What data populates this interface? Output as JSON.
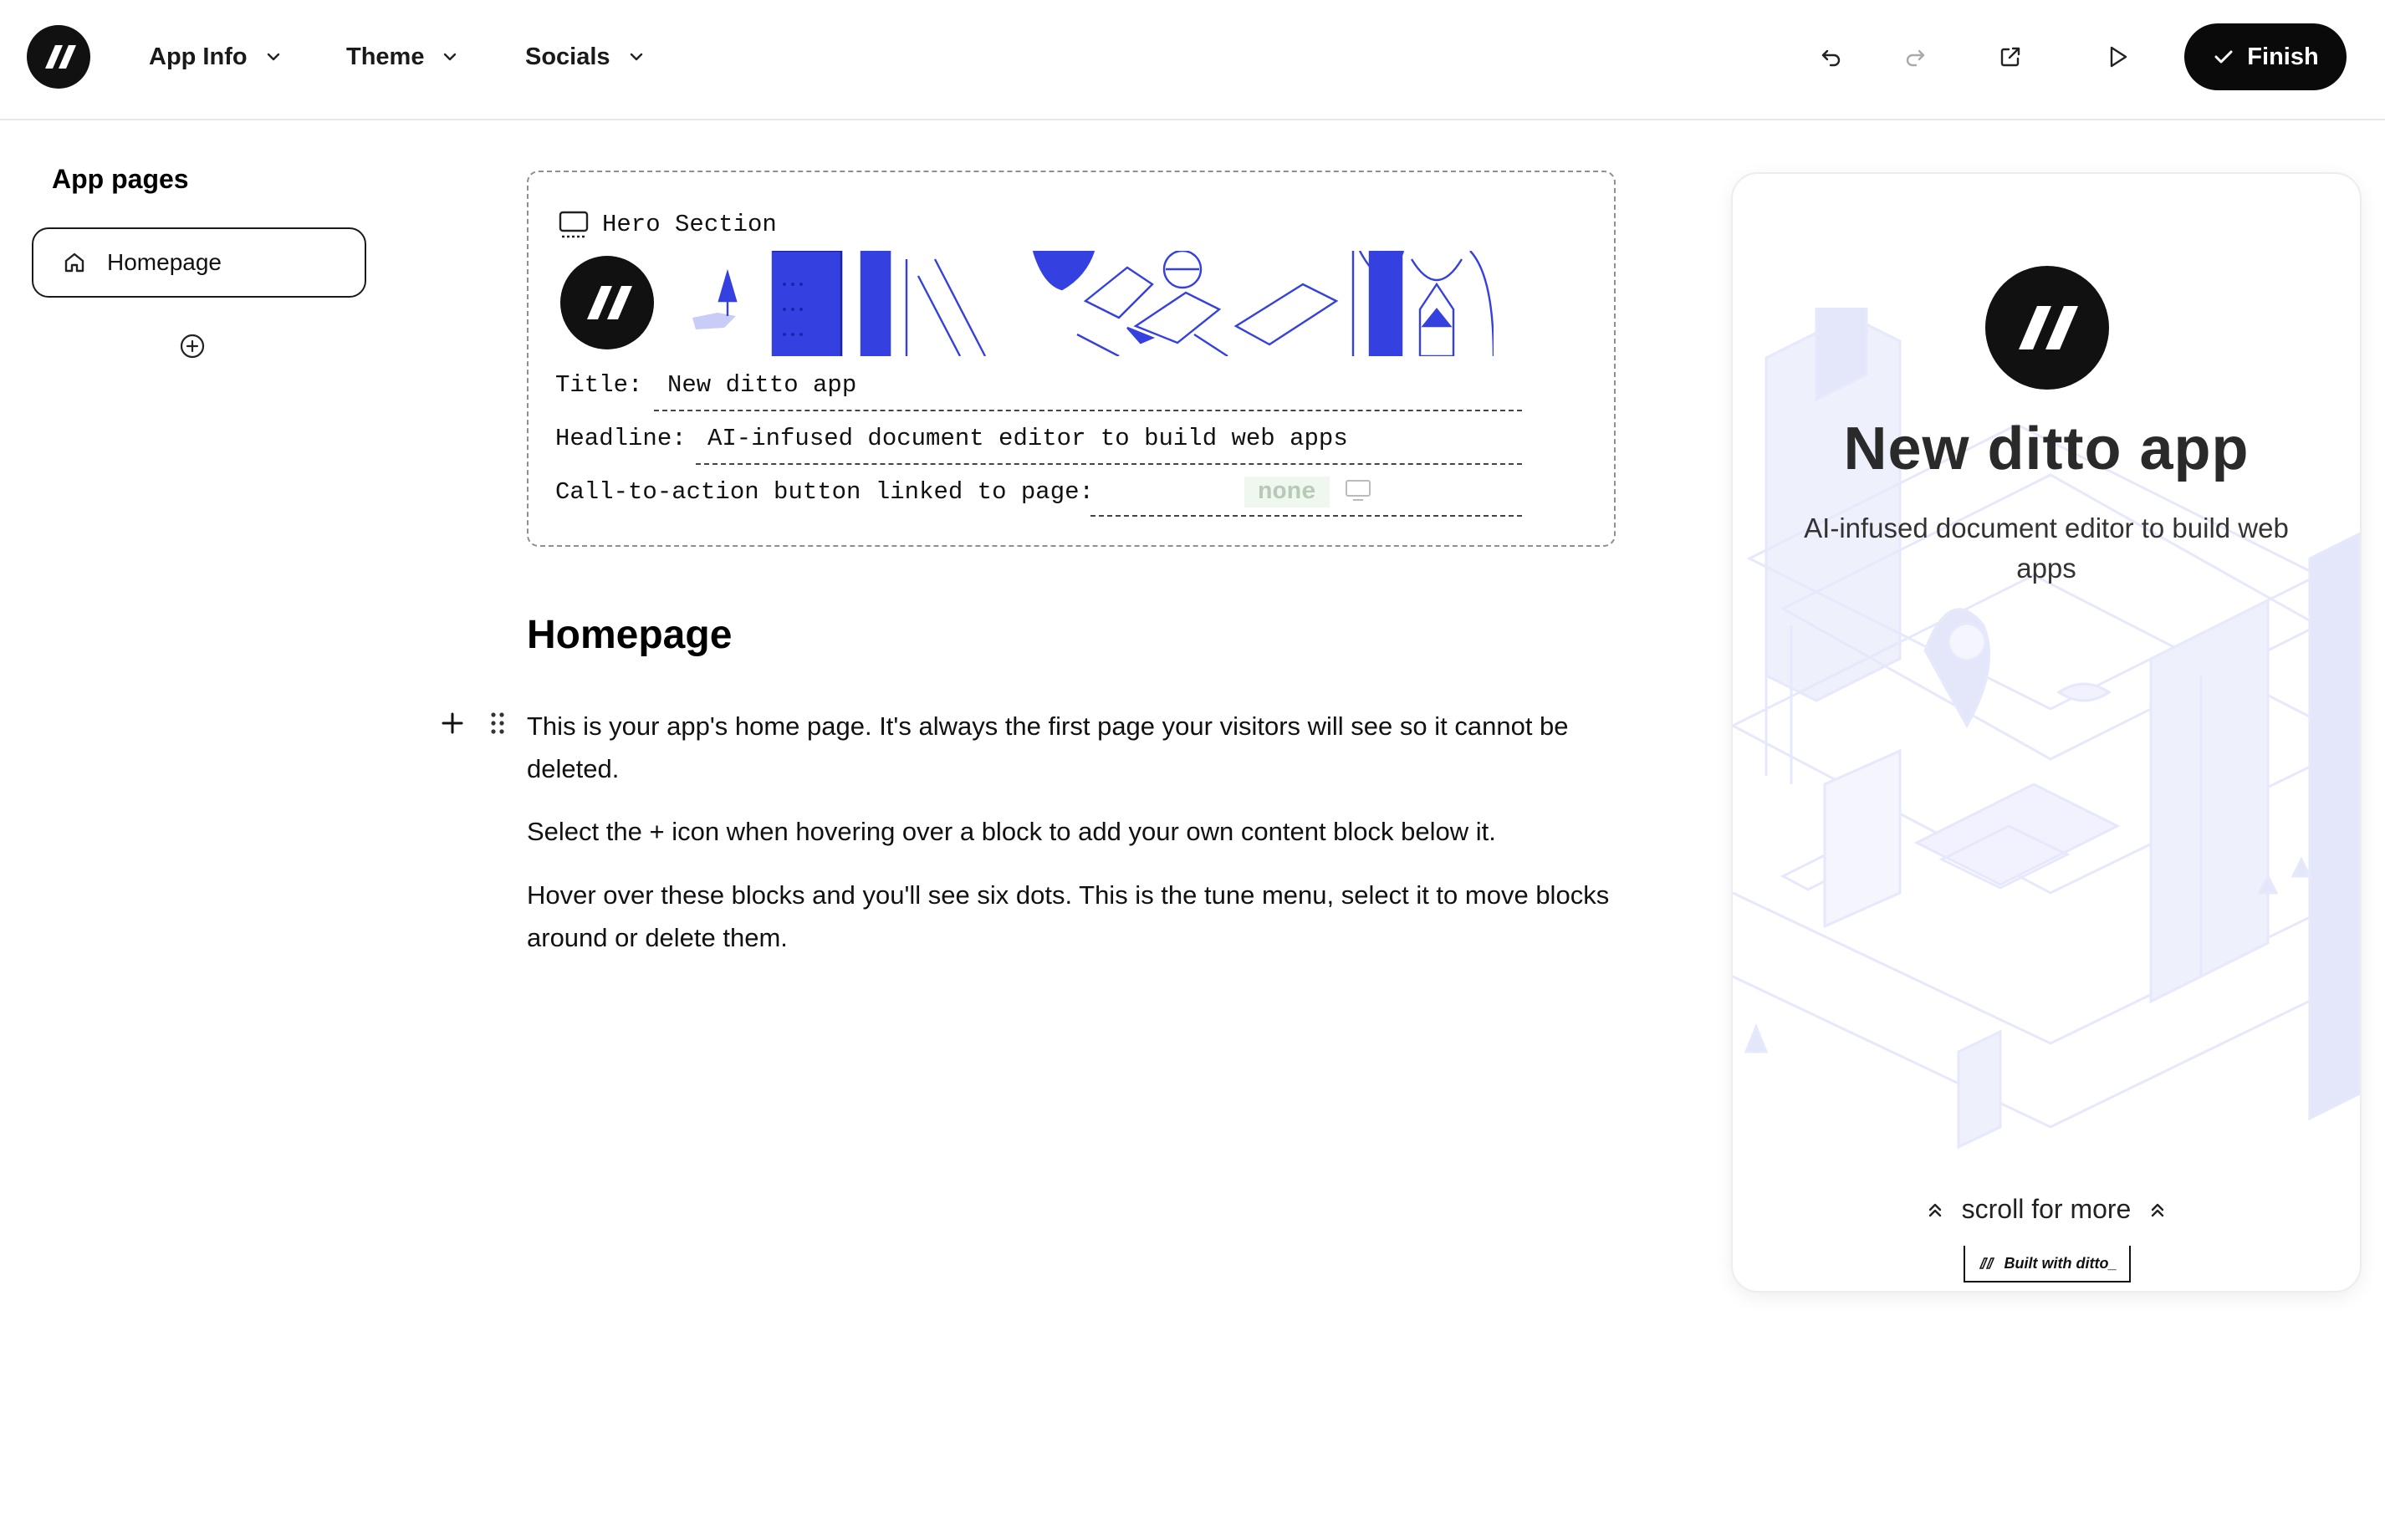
{
  "topbar": {
    "menus": [
      "App Info",
      "Theme",
      "Socials"
    ],
    "finish_label": "Finish"
  },
  "sidebar": {
    "title": "App pages",
    "pages": [
      {
        "label": "Homepage",
        "icon": "home-icon"
      }
    ]
  },
  "hero": {
    "section_label": "Hero Section",
    "title_label": "Title:",
    "title_value": "New ditto app",
    "headline_label": "Headline:",
    "headline_value": "AI-infused document editor to build web apps",
    "cta_label": "Call-to-action button linked to page:",
    "cta_value": "none"
  },
  "document": {
    "heading": "Homepage",
    "paragraphs": [
      "This is your app's home page. It's always the first page your visitors will see so it cannot be deleted.",
      "Select the + icon when hovering over a block to add your own content block below it.",
      "Hover over these blocks and you'll see six dots. This is the tune menu, select it to move blocks around or delete them."
    ]
  },
  "preview": {
    "title": "New ditto app",
    "headline": "AI-infused document editor to build web apps",
    "scroll_text": "scroll for more",
    "badge": "Built with ditto_"
  },
  "colors": {
    "accent_blue": "#3440e0",
    "dark": "#0a0a0a",
    "cta_none_bg": "#eef8ee",
    "cta_none_text": "#b8c9b8"
  }
}
